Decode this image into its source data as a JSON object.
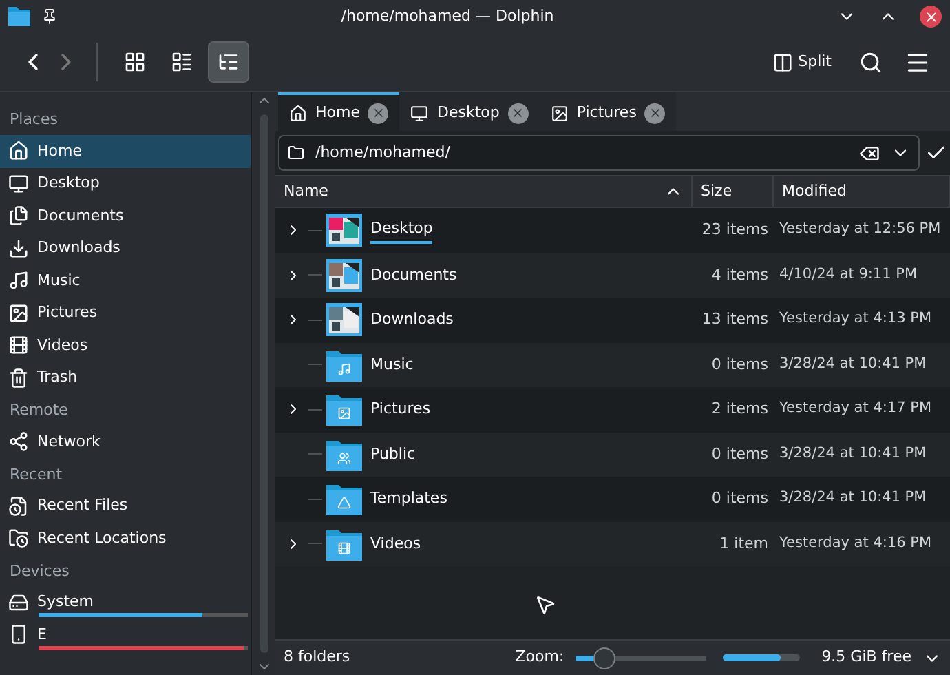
{
  "window": {
    "title": "/home/mohamed — Dolphin"
  },
  "toolbar": {
    "split_label": "Split",
    "view_modes": [
      {
        "selected": false
      },
      {
        "selected": false
      },
      {
        "selected": true
      }
    ]
  },
  "sidebar": {
    "sections": [
      {
        "title": "Places",
        "items": [
          {
            "label": "Home",
            "selected": true
          },
          {
            "label": "Desktop",
            "selected": false
          },
          {
            "label": "Documents",
            "selected": false
          },
          {
            "label": "Downloads",
            "selected": false
          },
          {
            "label": "Music",
            "selected": false
          },
          {
            "label": "Pictures",
            "selected": false
          },
          {
            "label": "Videos",
            "selected": false
          },
          {
            "label": "Trash",
            "selected": false
          }
        ]
      },
      {
        "title": "Remote",
        "items": [
          {
            "label": "Network",
            "selected": false
          }
        ]
      },
      {
        "title": "Recent",
        "items": [
          {
            "label": "Recent Files",
            "selected": false
          },
          {
            "label": "Recent Locations",
            "selected": false
          }
        ]
      },
      {
        "title": "Devices",
        "items": [
          {
            "label": "System",
            "selected": false,
            "level": 0.78,
            "color": "#3daee9"
          },
          {
            "label": "E",
            "selected": false,
            "level": 0.98,
            "color": "#da4453"
          }
        ]
      }
    ]
  },
  "tabs": [
    {
      "label": "Home",
      "selected": true
    },
    {
      "label": "Desktop",
      "selected": false
    },
    {
      "label": "Pictures",
      "selected": false
    }
  ],
  "location": {
    "value": "/home/mohamed/"
  },
  "table": {
    "columns": [
      "Name",
      "Size",
      "Modified"
    ],
    "rows": [
      {
        "name": "Desktop",
        "size": "23 items",
        "modified": "Yesterday at 12:56 PM",
        "kind": "preview",
        "expandable": true,
        "hovered": true
      },
      {
        "name": "Documents",
        "size": "4 items",
        "modified": "4/10/24 at 9:11 PM",
        "kind": "preview",
        "expandable": true,
        "hovered": false
      },
      {
        "name": "Downloads",
        "size": "13 items",
        "modified": "Yesterday at 4:13 PM",
        "kind": "preview",
        "expandable": true,
        "hovered": false
      },
      {
        "name": "Music",
        "size": "0 items",
        "modified": "3/28/24 at 10:41 PM",
        "kind": "folder",
        "expandable": false,
        "hovered": false
      },
      {
        "name": "Pictures",
        "size": "2 items",
        "modified": "Yesterday at 4:17 PM",
        "kind": "folder",
        "expandable": true,
        "hovered": false
      },
      {
        "name": "Public",
        "size": "0 items",
        "modified": "3/28/24 at 10:41 PM",
        "kind": "folder",
        "expandable": false,
        "hovered": false
      },
      {
        "name": "Templates",
        "size": "0 items",
        "modified": "3/28/24 at 10:41 PM",
        "kind": "folder",
        "expandable": false,
        "hovered": false
      },
      {
        "name": "Videos",
        "size": "1 item",
        "modified": "Yesterday at 4:16 PM",
        "kind": "folder",
        "expandable": true,
        "hovered": false
      }
    ]
  },
  "status_bar": {
    "text": "8 folders",
    "zoom_label": "Zoom:",
    "zoom": {
      "level": 0.15
    },
    "disk": {
      "level": 0.75
    },
    "free": "9.5 GiB free"
  }
}
